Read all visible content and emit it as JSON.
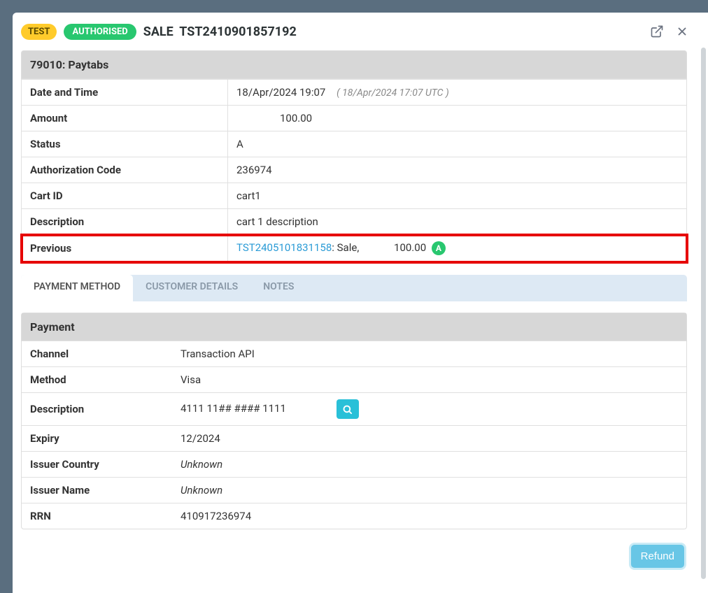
{
  "header": {
    "test_badge": "TEST",
    "auth_badge": "AUTHORISED",
    "sale_label": "SALE",
    "tx_id": "TST2410901857192"
  },
  "merchant": {
    "label": "79010: Paytabs"
  },
  "details": {
    "date_label": "Date and Time",
    "date_value": "18/Apr/2024 19:07",
    "date_utc": "( 18/Apr/2024 17:07 UTC )",
    "amount_label": "Amount",
    "amount_value": "100.00",
    "status_label": "Status",
    "status_value": "A",
    "auth_label": "Authorization Code",
    "auth_value": "236974",
    "cart_label": "Cart ID",
    "cart_value": "cart1",
    "desc_label": "Description",
    "desc_value": "cart 1 description",
    "prev_label": "Previous",
    "prev_link": "TST2405101831158",
    "prev_suffix": ": Sale,",
    "prev_amount": "100.00",
    "prev_badge": "A"
  },
  "tabs": {
    "payment": "PAYMENT METHOD",
    "customer": "CUSTOMER DETAILS",
    "notes": "NOTES"
  },
  "payment": {
    "header": "Payment",
    "channel_label": "Channel",
    "channel_value": "Transaction API",
    "method_label": "Method",
    "method_value": "Visa",
    "desc_label": "Description",
    "desc_value": "4111 11## #### 1111",
    "expiry_label": "Expiry",
    "expiry_value": "12/2024",
    "issuer_country_label": "Issuer Country",
    "issuer_country_value": "Unknown",
    "issuer_name_label": "Issuer Name",
    "issuer_name_value": "Unknown",
    "rrn_label": "RRN",
    "rrn_value": "410917236974"
  },
  "footer": {
    "refund": "Refund"
  }
}
